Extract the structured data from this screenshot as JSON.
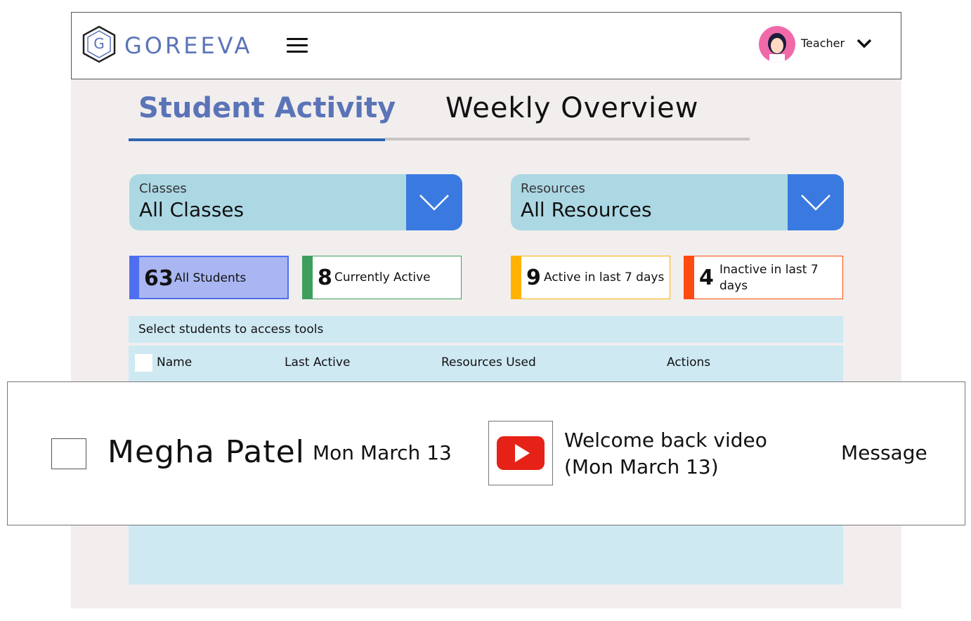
{
  "header": {
    "logo_letter": "G",
    "brand": "GOREEVA",
    "user_role": "Teacher"
  },
  "tabs": [
    {
      "label": "Student Activity",
      "active": true
    },
    {
      "label": "Weekly Overview",
      "active": false
    }
  ],
  "filters": {
    "classes": {
      "label": "Classes",
      "value": "All Classes"
    },
    "resources": {
      "label": "Resources",
      "value": "All Resources"
    }
  },
  "stats": [
    {
      "count": "63",
      "label": "All Students",
      "color": "#4f6ff0"
    },
    {
      "count": "8",
      "label": "Currently Active",
      "color": "#3e9e5e"
    },
    {
      "count": "9",
      "label": "Active in last 7 days",
      "color": "#ffb300"
    },
    {
      "count": "4",
      "label": "Inactive in last 7 days",
      "color": "#ff4a10"
    }
  ],
  "table": {
    "hint": "Select students to access tools",
    "columns": [
      "Name",
      "Last Active",
      "Resources Used",
      "Actions"
    ],
    "rows": [
      {
        "name": "Megha Patel",
        "last_active": "Mon March 13",
        "resource_line1": "Welcome back video",
        "resource_line2": "(Mon March 13)",
        "resource_icon": "youtube-icon",
        "action": "Message"
      }
    ]
  },
  "colors": {
    "brand": "#5b74b8",
    "dropdown_bg": "#acd8e4",
    "dropdown_button": "#3a7ae0",
    "table_bg": "#cfe9f3",
    "panel_bg": "#f1eeed",
    "youtube_red": "#e62117"
  }
}
